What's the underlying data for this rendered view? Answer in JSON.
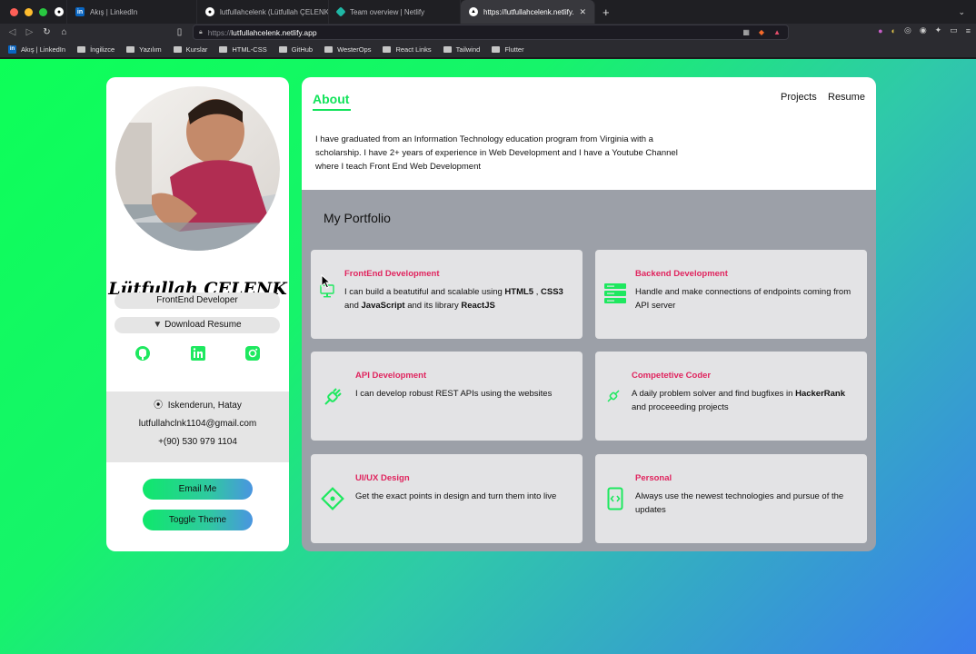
{
  "browser": {
    "tabs": [
      {
        "title": ""
      },
      {
        "title": "Akış | LinkedIn"
      },
      {
        "title": "lutfullahcelenk (Lütfullah ÇELENK)"
      },
      {
        "title": "Team overview | Netlify"
      },
      {
        "title": "https://lutfullahcelenk.netlify.app"
      }
    ],
    "url_scheme": "https://",
    "url_host": "lutfullahcelenk.netlify.app",
    "bookmarks": [
      "Akış | LinkedIn",
      "İngilizce",
      "Yazılım",
      "Kurslar",
      "HTML-CSS",
      "GitHub",
      "WesterOps",
      "React Links",
      "Tailwind",
      "Flutter"
    ]
  },
  "profile": {
    "name": "Lütfullah ÇELENK",
    "role": "FrontEnd Developer",
    "resume_button": "Download Resume",
    "location": "Iskenderun, Hatay",
    "email": "lutfullahclnk1104@gmail.com",
    "phone": "+(90) 530 979 1104",
    "email_button": "Email Me",
    "theme_button": "Toggle Theme"
  },
  "nav": {
    "about": "About",
    "projects": "Projects",
    "resume": "Resume"
  },
  "about_text": "I have graduated from an Information Technology education program from Virginia with a scholarship. I have 2+ years of experience in Web Development and I have a Youtube Channel where I teach Front End Web Development",
  "portfolio": {
    "title": "My Portfolio",
    "cards": [
      {
        "title": "FrontEnd Development",
        "icon": "monitor-icon",
        "desc_parts": [
          "I can build a beatutiful and scalable using ",
          "HTML5",
          " , ",
          "CSS3",
          " and ",
          "JavaScript",
          " and its library ",
          "ReactJS"
        ]
      },
      {
        "title": "Backend Development",
        "icon": "server-icon",
        "desc": "Handle and make connections of endpoints coming from API server"
      },
      {
        "title": "API Development",
        "icon": "plug-icon",
        "desc": "I can develop robust REST APIs using the websites"
      },
      {
        "title": "Competetive Coder",
        "icon": "plug-icon",
        "desc_parts": [
          "A daily problem solver and find bugfixes in ",
          "HackerRank",
          " and proceeeding projects"
        ]
      },
      {
        "title": "UI/UX Design",
        "icon": "design-icon",
        "desc": "Get the exact points in design and turn them into live"
      },
      {
        "title": "Personal",
        "icon": "code-icon",
        "desc": "Always use the newest technologies and pursue of the updates"
      }
    ]
  },
  "colors": {
    "accent_green": "#11e35a",
    "card_title": "#e0245e",
    "page_gradient_start": "#0dff58",
    "page_gradient_end": "#3b7ded"
  }
}
